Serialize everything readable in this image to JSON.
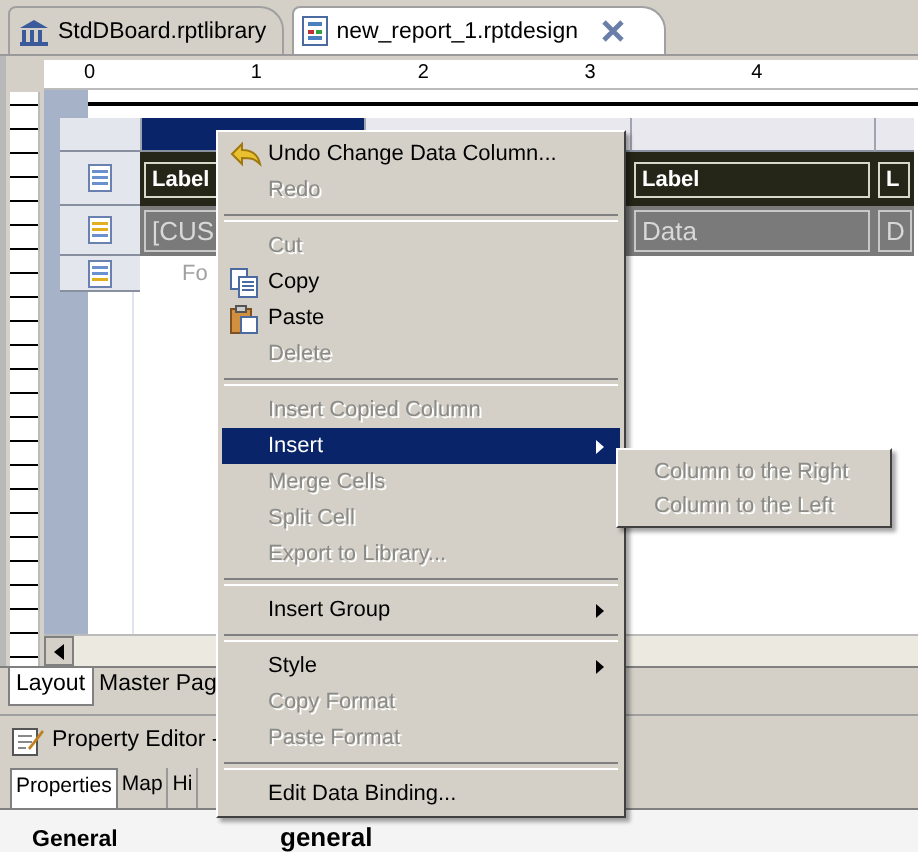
{
  "editor_tabs": [
    {
      "kind": "library",
      "label": "StdDBoard.rptlibrary",
      "selected": false
    },
    {
      "kind": "design",
      "label": "new_report_1.rptdesign",
      "selected": true
    }
  ],
  "ruler": {
    "marks": [
      "0",
      "1",
      "2",
      "3",
      "4"
    ]
  },
  "table": {
    "columns": [
      {
        "selected": true
      },
      {
        "selected": false
      },
      {
        "selected": false
      }
    ],
    "rows": [
      {
        "kind": "header",
        "cells": [
          "Label",
          "Label",
          "L"
        ]
      },
      {
        "kind": "detail",
        "cells": [
          "[CUS",
          "Data",
          "D"
        ]
      },
      {
        "kind": "footer",
        "cells": [
          "Fo"
        ]
      }
    ]
  },
  "menu": {
    "items": [
      {
        "kind": "undo",
        "label": "Undo Change Data Column...",
        "disabled": false,
        "selected": false,
        "has_submenu": false
      },
      {
        "kind": "item",
        "label": "Redo",
        "disabled": true,
        "selected": false,
        "has_submenu": false
      },
      {
        "kind": "separator"
      },
      {
        "kind": "item",
        "label": "Cut",
        "disabled": true,
        "selected": false,
        "has_submenu": false
      },
      {
        "kind": "copy",
        "label": "Copy",
        "disabled": false,
        "selected": false,
        "has_submenu": false
      },
      {
        "kind": "paste",
        "label": "Paste",
        "disabled": false,
        "selected": false,
        "has_submenu": false
      },
      {
        "kind": "item",
        "label": "Delete",
        "disabled": true,
        "selected": false,
        "has_submenu": false
      },
      {
        "kind": "separator"
      },
      {
        "kind": "item",
        "label": "Insert Copied Column",
        "disabled": true,
        "selected": false,
        "has_submenu": false
      },
      {
        "kind": "item",
        "label": "Insert",
        "disabled": false,
        "selected": true,
        "has_submenu": true
      },
      {
        "kind": "item",
        "label": "Merge Cells",
        "disabled": true,
        "selected": false,
        "has_submenu": false
      },
      {
        "kind": "item",
        "label": "Split Cell",
        "disabled": true,
        "selected": false,
        "has_submenu": false
      },
      {
        "kind": "item",
        "label": "Export to Library...",
        "disabled": true,
        "selected": false,
        "has_submenu": false
      },
      {
        "kind": "separator"
      },
      {
        "kind": "item",
        "label": "Insert Group",
        "disabled": false,
        "selected": false,
        "has_submenu": true
      },
      {
        "kind": "separator"
      },
      {
        "kind": "item",
        "label": "Style",
        "disabled": false,
        "selected": false,
        "has_submenu": true
      },
      {
        "kind": "item",
        "label": "Copy Format",
        "disabled": true,
        "selected": false,
        "has_submenu": false
      },
      {
        "kind": "item",
        "label": "Paste Format",
        "disabled": true,
        "selected": false,
        "has_submenu": false
      },
      {
        "kind": "separator"
      },
      {
        "kind": "item",
        "label": "Edit Data Binding...",
        "disabled": false,
        "selected": false,
        "has_submenu": false
      }
    ]
  },
  "submenu": {
    "items": [
      {
        "label": "Column to the Right",
        "disabled": true
      },
      {
        "label": "Column to the Left",
        "disabled": true
      }
    ]
  },
  "bottom_tabs": [
    {
      "label": "Layout",
      "selected": true
    },
    {
      "label": "Master Pag",
      "selected": false
    }
  ],
  "property_editor": {
    "title": "Property Editor -",
    "tabs": [
      {
        "label": "Properties",
        "selected": true
      },
      {
        "label": "Map",
        "selected": false
      },
      {
        "label": "Hi",
        "selected": false
      }
    ],
    "section": "General",
    "section_value": "general"
  }
}
